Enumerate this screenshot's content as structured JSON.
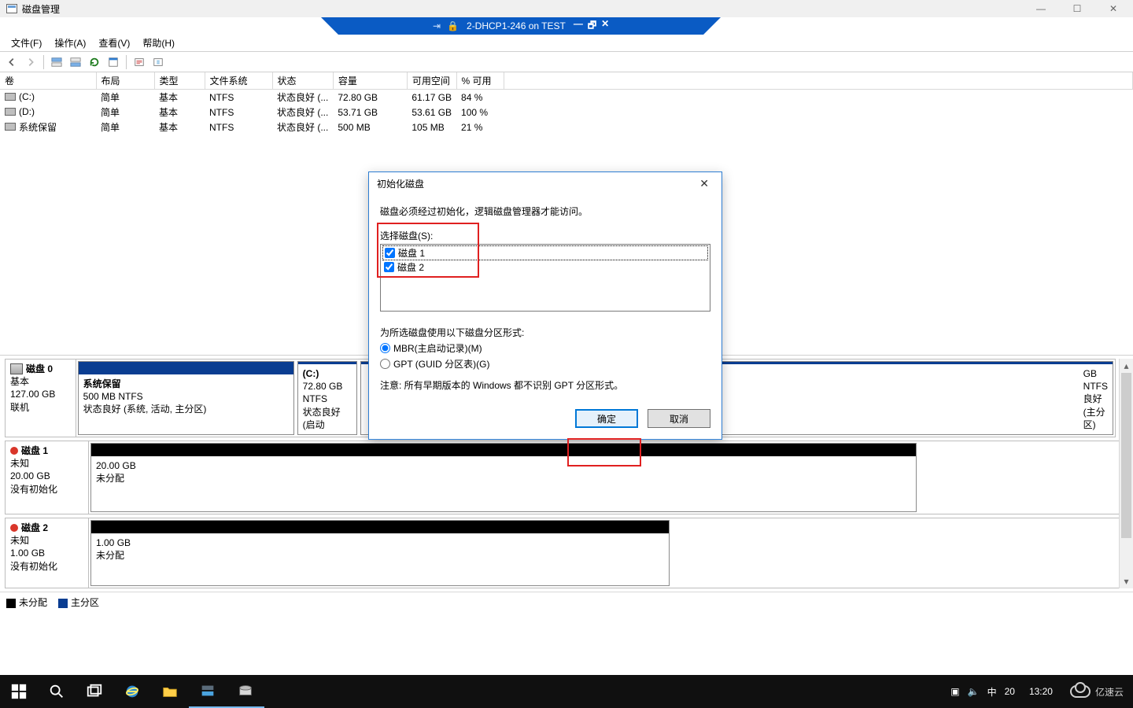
{
  "window": {
    "title": "磁盘管理"
  },
  "outer_controls": {
    "min": "—",
    "max": "☐",
    "close": "✕"
  },
  "vtab": {
    "pin": "⇥",
    "lock": "🔒",
    "title": "2-DHCP1-246 on TEST",
    "min": "—",
    "max": "🗗",
    "close": "✕"
  },
  "menu": {
    "file": "文件(F)",
    "action": "操作(A)",
    "view": "查看(V)",
    "help": "帮助(H)"
  },
  "table": {
    "headers": {
      "vol": "卷",
      "layout": "布局",
      "type": "类型",
      "fs": "文件系统",
      "status": "状态",
      "capacity": "容量",
      "free": "可用空间",
      "pct": "% 可用"
    },
    "rows": [
      {
        "vol": "(C:)",
        "layout": "简单",
        "type": "基本",
        "fs": "NTFS",
        "status": "状态良好 (...",
        "capacity": "72.80 GB",
        "free": "61.17 GB",
        "pct": "84 %"
      },
      {
        "vol": "(D:)",
        "layout": "简单",
        "type": "基本",
        "fs": "NTFS",
        "status": "状态良好 (...",
        "capacity": "53.71 GB",
        "free": "53.61 GB",
        "pct": "100 %"
      },
      {
        "vol": "系统保留",
        "layout": "简单",
        "type": "基本",
        "fs": "NTFS",
        "status": "状态良好 (...",
        "capacity": "500 MB",
        "free": "105 MB",
        "pct": "21 %"
      }
    ]
  },
  "disks": {
    "d0": {
      "name": "磁盘 0",
      "type": "基本",
      "size": "127.00 GB",
      "state": "联机",
      "parts": [
        {
          "title": "系统保留",
          "line2": "500 MB NTFS",
          "line3": "状态良好 (系统, 活动, 主分区)",
          "bar": "blue",
          "flex": "0 0 275px"
        },
        {
          "title": "(C:)",
          "line2": "72.80 GB NTFS",
          "line3": "状态良好 (启动",
          "bar": "blue",
          "flex": "0 0 76px"
        },
        {
          "title": "",
          "line2": "GB NTFS",
          "line3": "良好 (主分区)",
          "bar": "blue",
          "flex": "1 1 auto",
          "padl": "918px"
        }
      ]
    },
    "d1": {
      "name": "磁盘 1",
      "type": "未知",
      "size": "20.00 GB",
      "state": "没有初始化",
      "parts": [
        {
          "title": "",
          "line2": "20.00 GB",
          "line3": "未分配",
          "bar": "black",
          "flex": "0 0 1050px"
        }
      ]
    },
    "d2": {
      "name": "磁盘 2",
      "type": "未知",
      "size": "1.00 GB",
      "state": "没有初始化",
      "parts": [
        {
          "title": "",
          "line2": "1.00 GB",
          "line3": "未分配",
          "bar": "black",
          "flex": "0 0 736px"
        }
      ]
    }
  },
  "legend": {
    "unalloc": "未分配",
    "primary": "主分区"
  },
  "dialog": {
    "title": "初始化磁盘",
    "intro": "磁盘必须经过初始化，逻辑磁盘管理器才能访问。",
    "select_label": "选择磁盘(S):",
    "items": {
      "d1": "磁盘 1",
      "d2": "磁盘 2"
    },
    "style_label": "为所选磁盘使用以下磁盘分区形式:",
    "mbr": "MBR(主启动记录)(M)",
    "gpt": "GPT (GUID 分区表)(G)",
    "note": "注意: 所有早期版本的 Windows 都不识别 GPT 分区形式。",
    "ok": "确定",
    "cancel": "取消"
  },
  "taskbar": {
    "ime": "中",
    "pretxt": "20",
    "time": "13:20",
    "brand": "亿速云"
  }
}
